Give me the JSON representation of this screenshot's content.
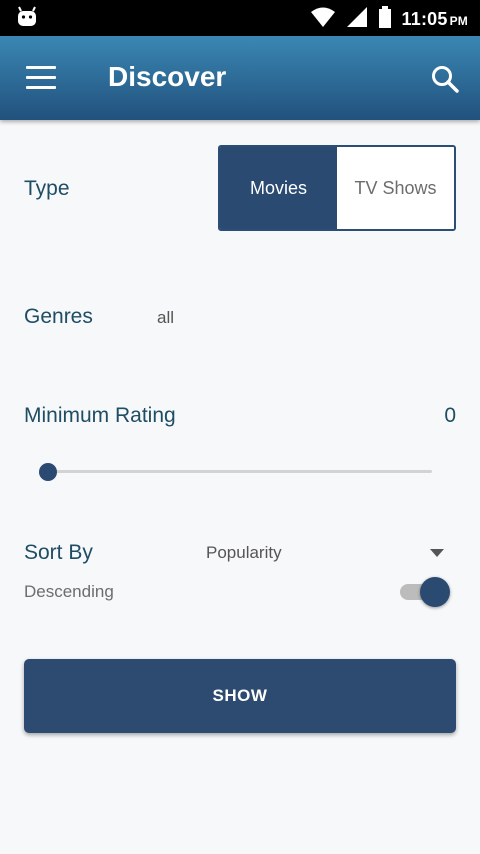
{
  "status_bar": {
    "time": "11:05",
    "ampm": "PM",
    "icons": [
      "android-icon",
      "wifi-icon",
      "signal-icon",
      "battery-icon"
    ]
  },
  "app_bar": {
    "title": "Discover",
    "menu_icon": "hamburger-menu-icon",
    "search_icon": "search-icon"
  },
  "type": {
    "label": "Type",
    "options": [
      "Movies",
      "TV Shows"
    ],
    "selected": "Movies"
  },
  "genres": {
    "label": "Genres",
    "value": "all"
  },
  "minimum_rating": {
    "label": "Minimum Rating",
    "value": "0",
    "fraction": 0
  },
  "sort_by": {
    "label": "Sort By",
    "selected": "Popularity",
    "descending_label": "Descending",
    "descending_on": true
  },
  "show_button": {
    "label": "SHOW"
  },
  "colors": {
    "primary": "#2a4a72",
    "appbar_top": "#3a87b4",
    "appbar_bottom": "#22517d",
    "label_text": "#1f4d64"
  }
}
